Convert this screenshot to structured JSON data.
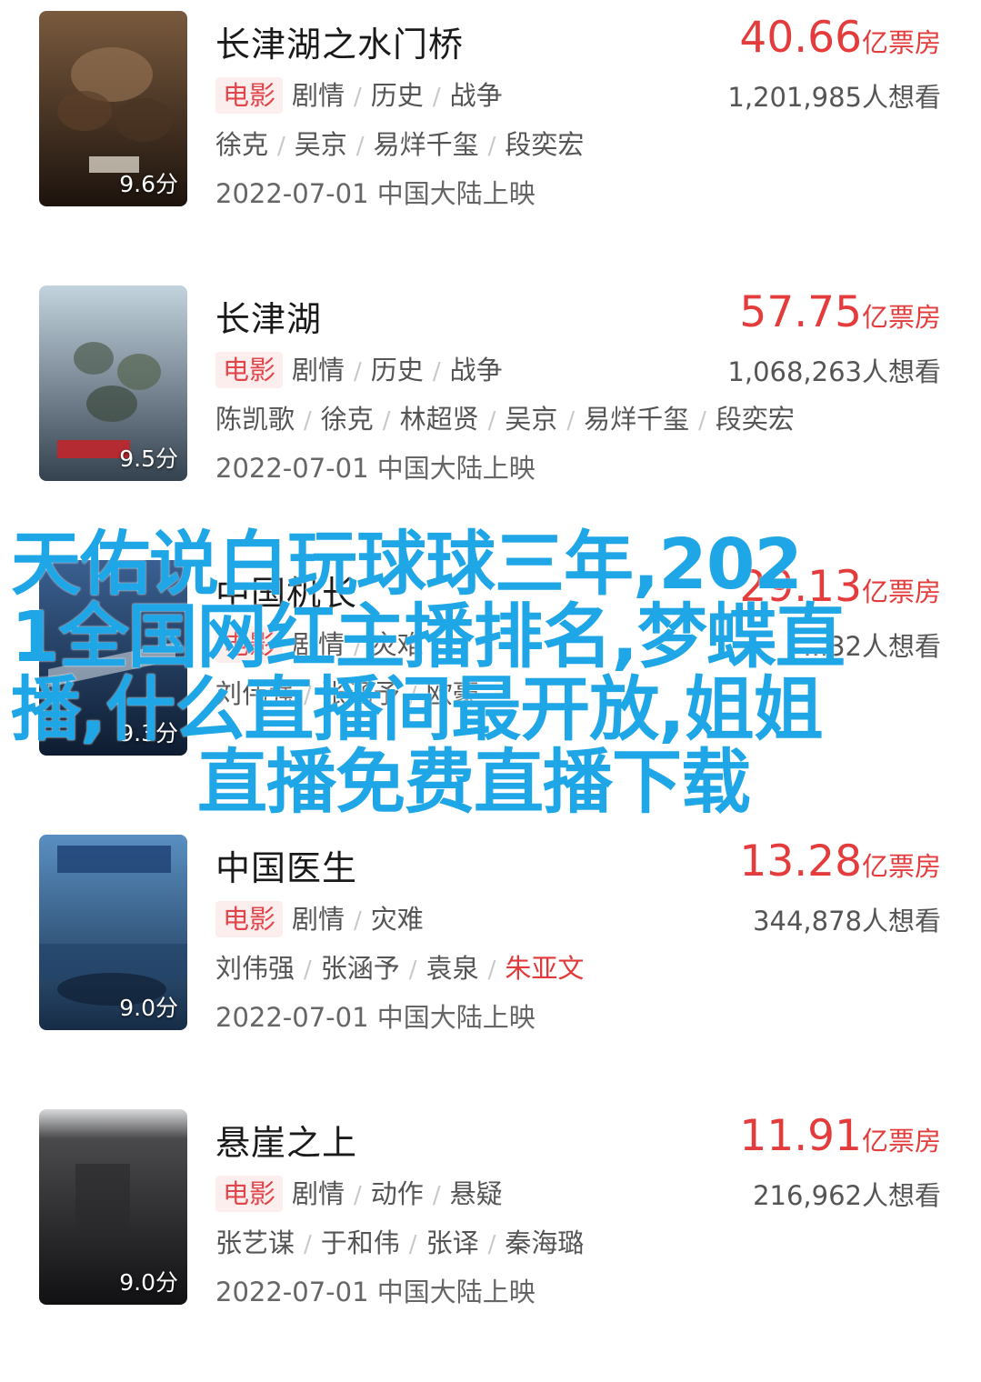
{
  "movies": [
    {
      "title": "长津湖之水门桥",
      "score": "9.6分",
      "tag": "电影",
      "genres": [
        "剧情",
        "历史",
        "战争"
      ],
      "cast": [
        "徐克",
        "吴京",
        "易烊千玺",
        "段奕宏"
      ],
      "release": "2022-07-01 中国大陆上映",
      "box_office": "40.66",
      "box_unit": "亿票房",
      "want": "1,201,985人想看",
      "poster_colors": [
        "#6f4b2f",
        "#2a1c14"
      ]
    },
    {
      "title": "长津湖",
      "score": "9.5分",
      "tag": "电影",
      "genres": [
        "剧情",
        "历史",
        "战争"
      ],
      "cast": [
        "陈凯歌",
        "徐克",
        "林超贤",
        "吴京",
        "易烊千玺",
        "段奕宏"
      ],
      "release": "2022-07-01 中国大陆上映",
      "box_office": "57.75",
      "box_unit": "亿票房",
      "want": "1,068,263人想看",
      "poster_colors": [
        "#9fb7c9",
        "#3d4f5f"
      ]
    },
    {
      "title": "中国机长",
      "score": "9.3分",
      "tag": "电影",
      "genres": [
        "剧情",
        "灾难"
      ],
      "cast": [
        "刘伟强",
        "张涵予",
        "欧豪"
      ],
      "release": "",
      "box_office": "29.13",
      "box_unit": "亿票房",
      "want": "...32人想看",
      "poster_colors": [
        "#2c4d7a",
        "#0f1f36"
      ]
    },
    {
      "title": "中国医生",
      "score": "9.0分",
      "tag": "电影",
      "genres": [
        "剧情",
        "灾难"
      ],
      "cast": [
        "刘伟强",
        "张涵予",
        "袁泉",
        "朱亚文"
      ],
      "cast_highlight_index": 3,
      "release": "2022-07-01 中国大陆上映",
      "box_office": "13.28",
      "box_unit": "亿票房",
      "want": "344,878人想看",
      "poster_colors": [
        "#4a7fb5",
        "#1b3552"
      ]
    },
    {
      "title": "悬崖之上",
      "score": "9.0分",
      "tag": "电影",
      "genres": [
        "剧情",
        "动作",
        "悬疑"
      ],
      "cast": [
        "张艺谋",
        "于和伟",
        "张译",
        "秦海璐"
      ],
      "release": "2022-07-01 中国大陆上映",
      "box_office": "11.91",
      "box_unit": "亿票房",
      "want": "216,962人想看",
      "poster_colors": [
        "#3a3a3c",
        "#121214"
      ]
    }
  ],
  "overlay_text": {
    "line1": "天佑说白玩球球三年,202",
    "line2": "1全国网红主播排名,梦蝶直",
    "line3": "播,什么直播间最开放,姐姐",
    "line4": "直播免费直播下载"
  }
}
